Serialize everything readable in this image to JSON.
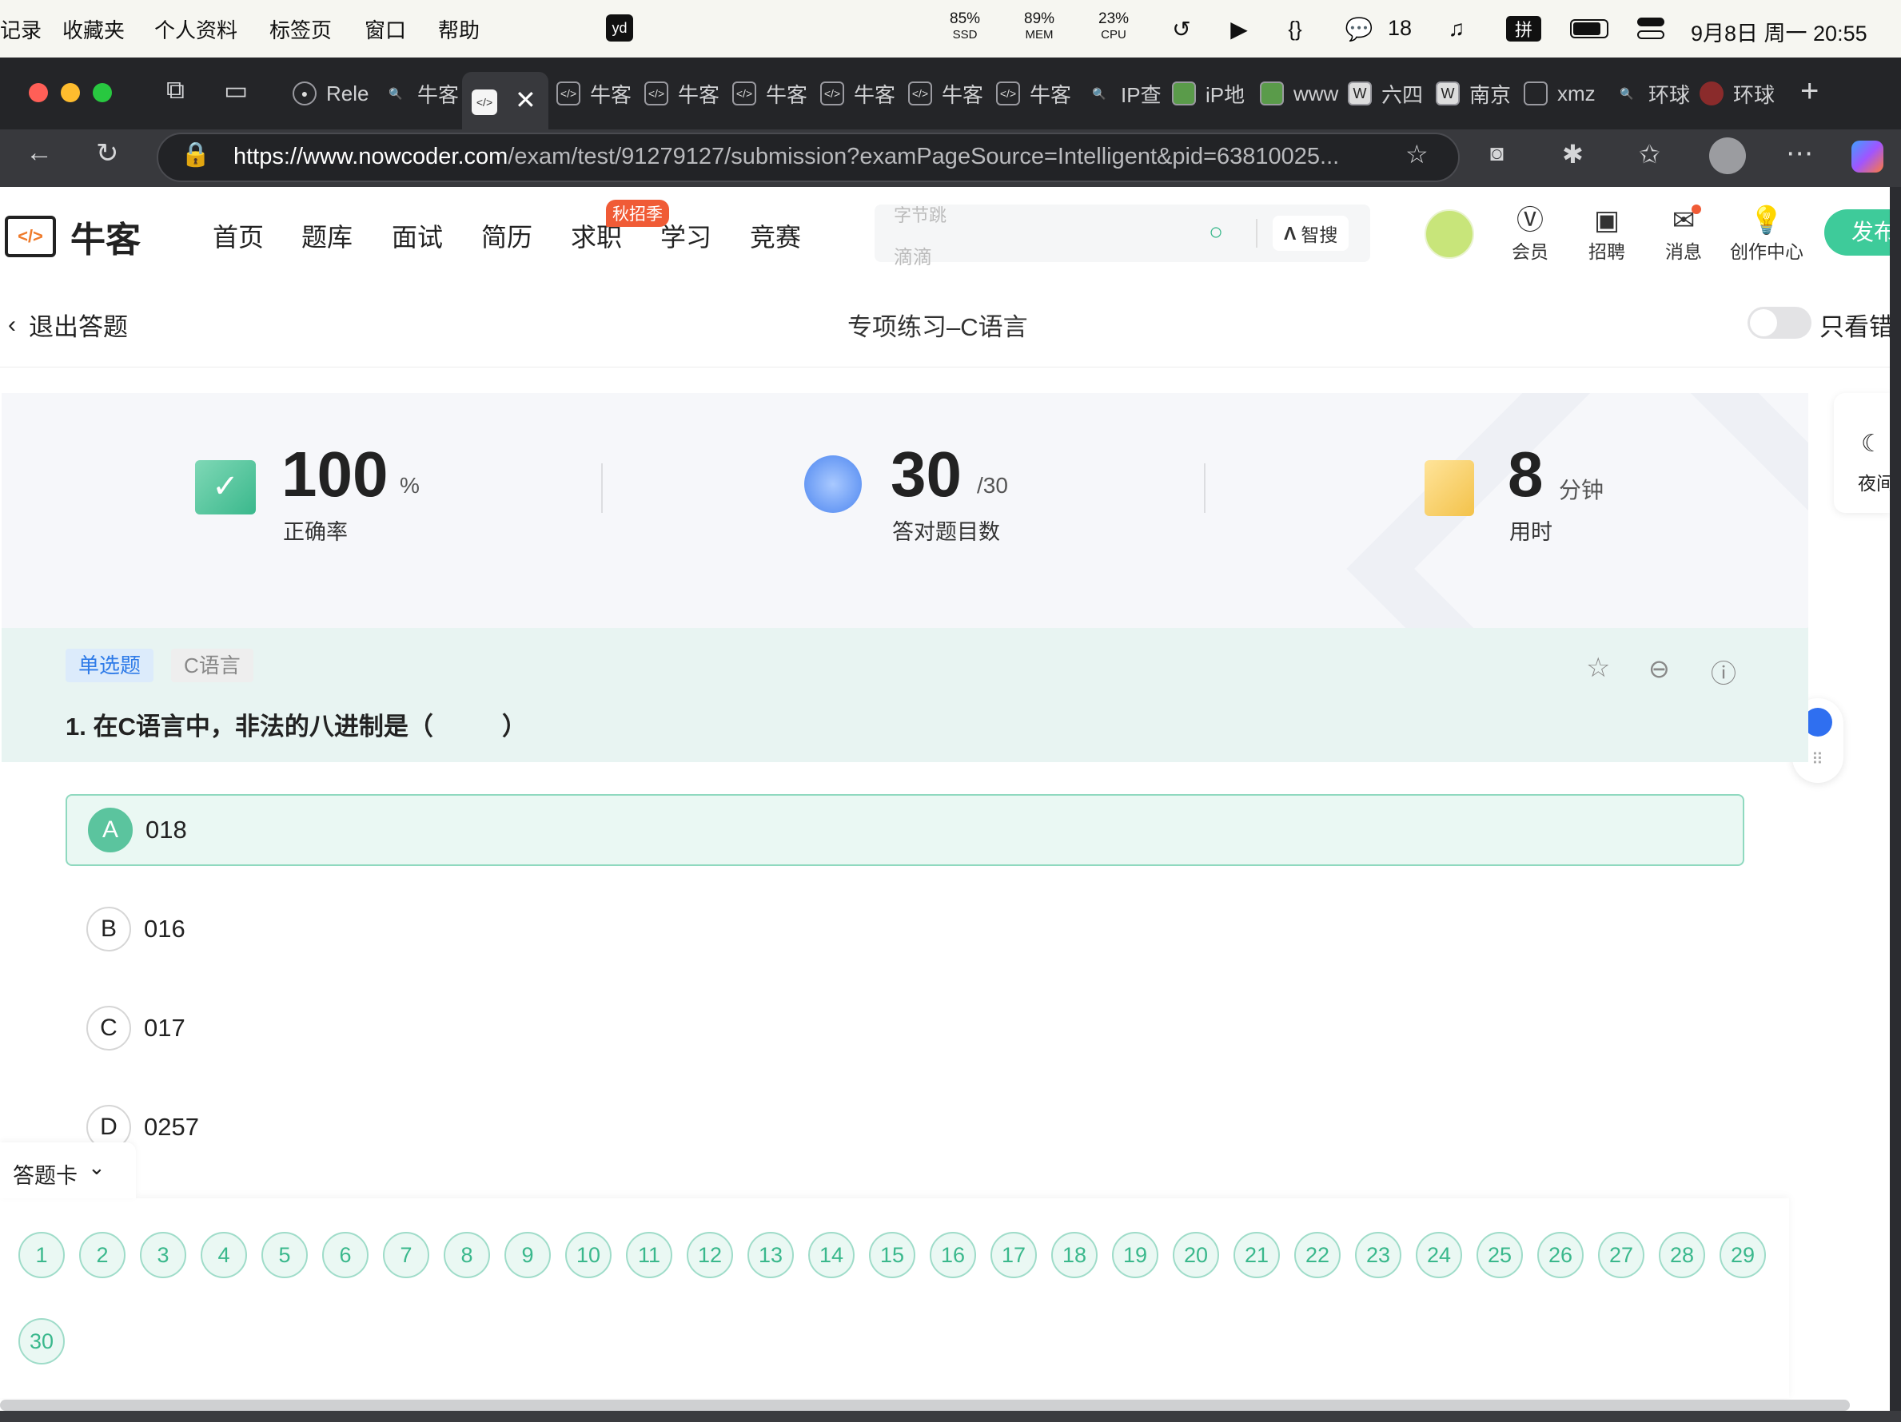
{
  "menubar": {
    "items": [
      "记录",
      "收藏夹",
      "个人资料",
      "标签页",
      "窗口",
      "帮助"
    ],
    "app_badge": "yd",
    "stats": [
      {
        "value": "85%",
        "label": "SSD"
      },
      {
        "value": "89%",
        "label": "MEM"
      },
      {
        "value": "23%",
        "label": "CPU"
      }
    ],
    "wechat_count": "18",
    "input_method": "拼",
    "datetime": "9月8日 周一  20:55"
  },
  "tabs": [
    {
      "label": "Rele"
    },
    {
      "label": "牛客"
    },
    {
      "label": "",
      "active": true
    },
    {
      "label": "牛客"
    },
    {
      "label": "牛客"
    },
    {
      "label": "牛客"
    },
    {
      "label": "牛客"
    },
    {
      "label": "牛客"
    },
    {
      "label": "牛客"
    },
    {
      "label": "IP查"
    },
    {
      "label": "iP地"
    },
    {
      "label": "www"
    },
    {
      "label": "六四"
    },
    {
      "label": "南京"
    },
    {
      "label": "xmz"
    },
    {
      "label": "环球"
    },
    {
      "label": "环球"
    }
  ],
  "address": {
    "url_host": "https://www.nowcoder.com",
    "url_path": "/exam/test/91279127/submission?examPageSource=Intelligent&pid=63810025..."
  },
  "site": {
    "logo_text": "牛客",
    "nav": [
      "首页",
      "题库",
      "面试",
      "简历",
      "求职",
      "学习",
      "竞赛"
    ],
    "nav_badge": "秋招季",
    "search_placeholder_top": "字节跳",
    "search_placeholder": "滴滴",
    "ai_search": "智搜",
    "header_icons": [
      {
        "label": "会员",
        "icon": "vip-icon"
      },
      {
        "label": "招聘",
        "icon": "recruit-icon"
      },
      {
        "label": "消息",
        "icon": "mail-icon"
      },
      {
        "label": "创作中心",
        "icon": "bulb-icon"
      }
    ],
    "publish_label": "发布"
  },
  "exam": {
    "exit_label": "退出答题",
    "title": "专项练习–C语言",
    "toggle_label": "只看错"
  },
  "summary": {
    "accuracy": {
      "value": "100",
      "unit": "%",
      "label": "正确率"
    },
    "correct": {
      "value": "30",
      "unit": "/30",
      "label": "答对题目数"
    },
    "time": {
      "value": "8",
      "unit": "分钟",
      "label": "用时"
    }
  },
  "side": {
    "night_label": "夜间"
  },
  "question": {
    "type_tag": "单选题",
    "subject_tag": "C语言",
    "text": "1. 在C语言中，非法的八进制是（          ）",
    "options": [
      {
        "letter": "A",
        "text": "018",
        "selected": true
      },
      {
        "letter": "B",
        "text": "016"
      },
      {
        "letter": "C",
        "text": "017"
      },
      {
        "letter": "D",
        "text": "0257"
      }
    ]
  },
  "card": {
    "label": "答题卡",
    "numbers": [
      "1",
      "2",
      "3",
      "4",
      "5",
      "6",
      "7",
      "8",
      "9",
      "10",
      "11",
      "12",
      "13",
      "14",
      "15",
      "16",
      "17",
      "18",
      "19",
      "20",
      "21",
      "22",
      "23",
      "24",
      "25",
      "26",
      "27",
      "28",
      "29",
      "30"
    ]
  },
  "colors": {
    "accent": "#3ab88c",
    "tab_blue": "#2e7be8",
    "dark_chrome": "#242528"
  }
}
